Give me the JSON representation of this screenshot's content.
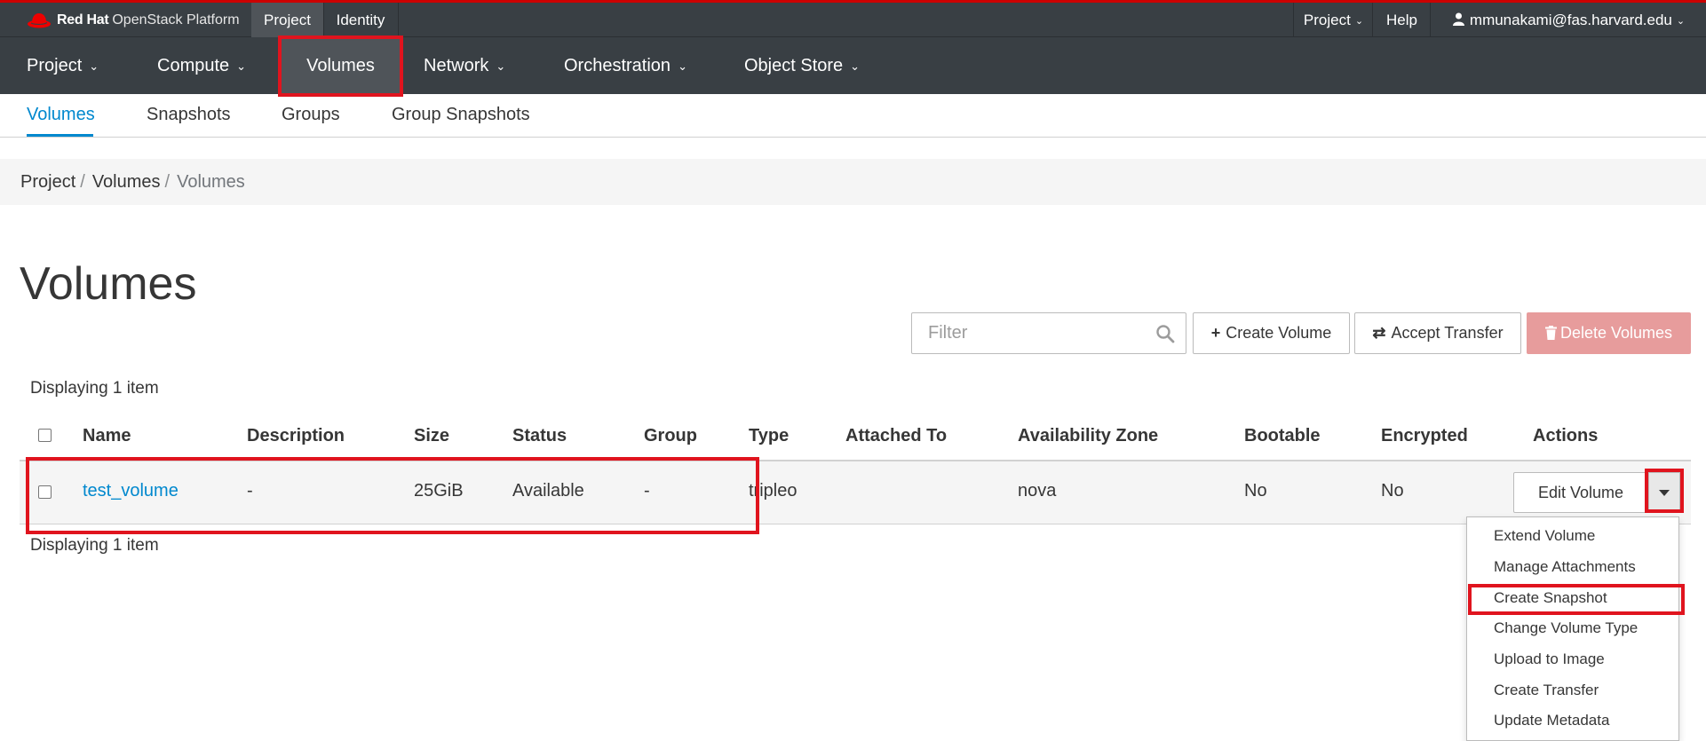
{
  "brand": {
    "bold": "Red Hat",
    "rest": "OpenStack Platform"
  },
  "context_tabs": {
    "project": "Project",
    "identity": "Identity"
  },
  "utility": {
    "project": "Project",
    "help": "Help",
    "user": "mmunakami@fas.harvard.edu"
  },
  "main_nav": [
    {
      "label": "Project"
    },
    {
      "label": "Compute"
    },
    {
      "label": "Volumes"
    },
    {
      "label": "Network"
    },
    {
      "label": "Orchestration"
    },
    {
      "label": "Object Store"
    }
  ],
  "sub_nav": [
    {
      "label": "Volumes"
    },
    {
      "label": "Snapshots"
    },
    {
      "label": "Groups"
    },
    {
      "label": "Group Snapshots"
    }
  ],
  "breadcrumb": [
    "Project",
    "Volumes",
    "Volumes"
  ],
  "page_title": "Volumes",
  "filter": {
    "placeholder": "Filter"
  },
  "toolbar": {
    "create_label": "Create Volume",
    "accept_label": "Accept Transfer",
    "delete_label": "Delete Volumes"
  },
  "displaying": "Displaying 1 item",
  "table": {
    "columns": [
      "Name",
      "Description",
      "Size",
      "Status",
      "Group",
      "Type",
      "Attached To",
      "Availability Zone",
      "Bootable",
      "Encrypted",
      "Actions"
    ],
    "rows": [
      {
        "name": "test_volume",
        "description": "-",
        "size": "25GiB",
        "status": "Available",
        "group": "-",
        "type": "tripleo",
        "attached_to": "",
        "availability_zone": "nova",
        "bootable": "No",
        "encrypted": "No",
        "action_label": "Edit Volume"
      }
    ]
  },
  "row_actions_menu": [
    "Extend Volume",
    "Manage Attachments",
    "Create Snapshot",
    "Change Volume Type",
    "Upload to Image",
    "Create Transfer",
    "Update Metadata"
  ],
  "colors": {
    "topbar_bg": "#393f44",
    "brand_red": "#cc0000",
    "link_blue": "#0088ce",
    "delete_button": "#e79c9c",
    "highlight_red": "#e0141e"
  }
}
